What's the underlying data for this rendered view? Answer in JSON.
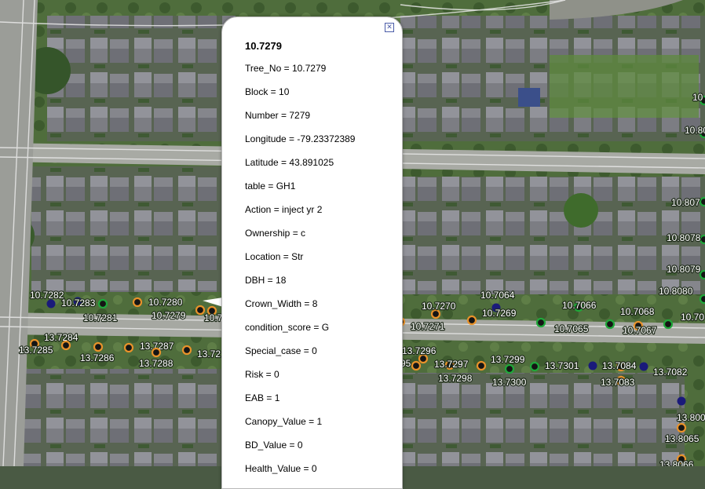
{
  "popup": {
    "title": "10.7279",
    "close_icon": "close-icon",
    "rows": [
      {
        "key": "Tree_No",
        "value": "10.7279"
      },
      {
        "key": "Block",
        "value": "10"
      },
      {
        "key": "Number",
        "value": "7279"
      },
      {
        "key": "Longitude",
        "value": "-79.23372389"
      },
      {
        "key": "Latitude",
        "value": "43.891025"
      },
      {
        "key": "table",
        "value": "GH1"
      },
      {
        "key": "Action",
        "value": "inject yr 2"
      },
      {
        "key": "Ownership",
        "value": "c"
      },
      {
        "key": "Location",
        "value": "Str"
      },
      {
        "key": "DBH",
        "value": "18"
      },
      {
        "key": "Crown_Width",
        "value": "8"
      },
      {
        "key": "condition_score",
        "value": "G"
      },
      {
        "key": "Special_case",
        "value": "0"
      },
      {
        "key": "Risk",
        "value": "0"
      },
      {
        "key": "EAB",
        "value": "1"
      },
      {
        "key": "Canopy_Value",
        "value": "1"
      },
      {
        "key": "BD_Value",
        "value": "0"
      },
      {
        "key": "Health_Value",
        "value": "0"
      }
    ]
  },
  "marker_colors": {
    "orange": "#e8922a",
    "green": "#1fa83a",
    "navy": "#1a1a7a"
  },
  "tree_markers": [
    {
      "label": "10.7282",
      "color": "navy"
    },
    {
      "label": "10.7283",
      "color": "navy"
    },
    {
      "label": "10.7281",
      "color": "green"
    },
    {
      "label": "10.7280",
      "color": "orange"
    },
    {
      "label": "10.7279",
      "color": "orange"
    },
    {
      "label": "10.7278",
      "color": "orange"
    },
    {
      "label": "10.7270",
      "color": "orange"
    },
    {
      "label": "10.7271",
      "color": "orange"
    },
    {
      "label": "10.7064",
      "color": "navy"
    },
    {
      "label": "10.7269",
      "color": "orange"
    },
    {
      "label": "10.7066",
      "color": "green"
    },
    {
      "label": "10.7065",
      "color": "green"
    },
    {
      "label": "10.7068",
      "color": "green"
    },
    {
      "label": "10.7067",
      "color": "orange"
    },
    {
      "label": "10.8080",
      "color": "green"
    },
    {
      "label": "10.70",
      "color": "green"
    },
    {
      "label": "10.8079",
      "color": "green"
    },
    {
      "label": "10.8078",
      "color": "green"
    },
    {
      "label": "10.807",
      "color": "green"
    },
    {
      "label": "10.80",
      "color": "green"
    },
    {
      "label": "10",
      "color": "green"
    },
    {
      "label": "13.7284",
      "color": "orange"
    },
    {
      "label": "13.7285",
      "color": "orange"
    },
    {
      "label": "13.7286",
      "color": "orange"
    },
    {
      "label": "13.7287",
      "color": "orange"
    },
    {
      "label": "13.7288",
      "color": "orange"
    },
    {
      "label": "13.72",
      "color": "orange"
    },
    {
      "label": "13.7296",
      "color": "orange"
    },
    {
      "label": "95",
      "color": "orange"
    },
    {
      "label": "13.7297",
      "color": "orange"
    },
    {
      "label": "13.7298",
      "color": "orange"
    },
    {
      "label": "13.7299",
      "color": "green"
    },
    {
      "label": "13.7300",
      "color": "green"
    },
    {
      "label": "13.7301",
      "color": "navy"
    },
    {
      "label": "13.7084",
      "color": "orange"
    },
    {
      "label": "13.7083",
      "color": "orange"
    },
    {
      "label": "13.7082",
      "color": "navy"
    },
    {
      "label": "13.800",
      "color": "navy"
    },
    {
      "label": "13.8065",
      "color": "orange"
    },
    {
      "label": "13.8066",
      "color": "orange"
    }
  ]
}
